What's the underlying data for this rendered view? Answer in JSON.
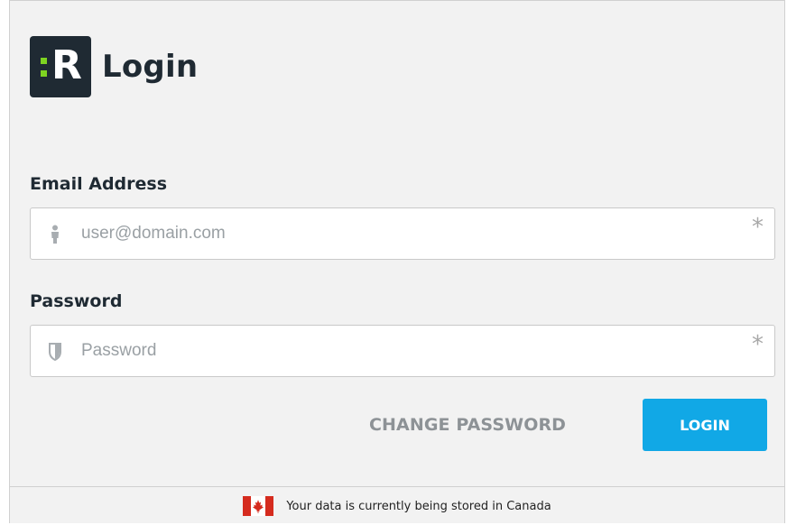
{
  "header": {
    "logo_letter": "R",
    "title": "Login"
  },
  "email": {
    "label": "Email Address",
    "placeholder": "user@domain.com",
    "value": "",
    "required_marker": "*",
    "icon": "person-icon"
  },
  "password": {
    "label": "Password",
    "placeholder": "Password",
    "value": "",
    "required_marker": "*",
    "icon": "shield-icon"
  },
  "actions": {
    "change_password_label": "CHANGE PASSWORD",
    "login_label": "LOGIN"
  },
  "footer": {
    "flag_icon": "canada-flag-icon",
    "text": "Your data is currently being stored in Canada"
  },
  "colors": {
    "accent": "#11a8e6",
    "logo_bg": "#1f2a33",
    "logo_dots": "#7ed321",
    "flag_red": "#d52b1e"
  }
}
